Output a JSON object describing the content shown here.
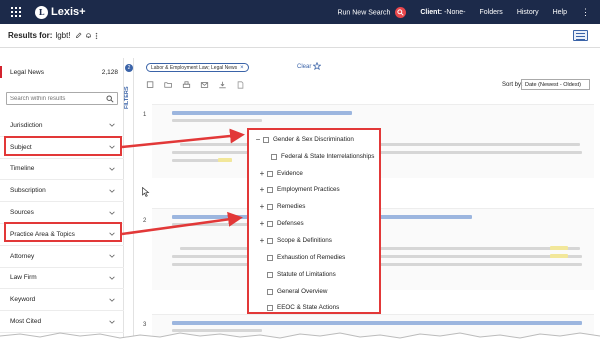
{
  "topbar": {
    "brand": "Lexis+",
    "brand_mark": "L",
    "new_search": "Run New Search",
    "client_label": "Client:",
    "client_value": "-None-",
    "nav": [
      "Folders",
      "History",
      "Help"
    ],
    "more": "⋮"
  },
  "results": {
    "label": "Results for:",
    "query": "lgbt!"
  },
  "left_panel": {
    "legal_news_label": "Legal News",
    "legal_news_count": "2,128",
    "search_placeholder": "Search within results",
    "facets": [
      "Jurisdiction",
      "Subject",
      "Timeline",
      "Subscription",
      "Sources",
      "Practice Area & Topics",
      "Attorney",
      "Law Firm",
      "Keyword",
      "Most Cited"
    ]
  },
  "filters_rail": {
    "badge": "2",
    "label": "FILTERS"
  },
  "toolbar": {
    "chip": "Labor & Employment Law; Legal News",
    "chip_close": "×",
    "clear": "Clear",
    "sort_label": "Sort by:",
    "sort_value": "Date (Newest - Oldest)"
  },
  "result_numbers": [
    "1",
    "2",
    "3"
  ],
  "subject_popup": {
    "items": [
      {
        "label": "Gender & Sex Discrimination",
        "toggle": "−"
      },
      {
        "label": "Federal & State Interrelationships",
        "toggle": ""
      },
      {
        "label": "Evidence",
        "toggle": "+"
      },
      {
        "label": "Employment Practices",
        "toggle": "+"
      },
      {
        "label": "Remedies",
        "toggle": "+"
      },
      {
        "label": "Defenses",
        "toggle": "+"
      },
      {
        "label": "Scope & Definitions",
        "toggle": "+"
      },
      {
        "label": "Exhaustion of Remedies",
        "toggle": ""
      },
      {
        "label": "Statute of Limitations",
        "toggle": ""
      },
      {
        "label": "General Overview",
        "toggle": ""
      },
      {
        "label": "EEOC & State Actions",
        "toggle": ""
      }
    ]
  },
  "colors": {
    "topbar": "#1c2a4a",
    "highlight": "#e23838",
    "accent": "#3a63a8",
    "search_button": "#e8474c"
  }
}
